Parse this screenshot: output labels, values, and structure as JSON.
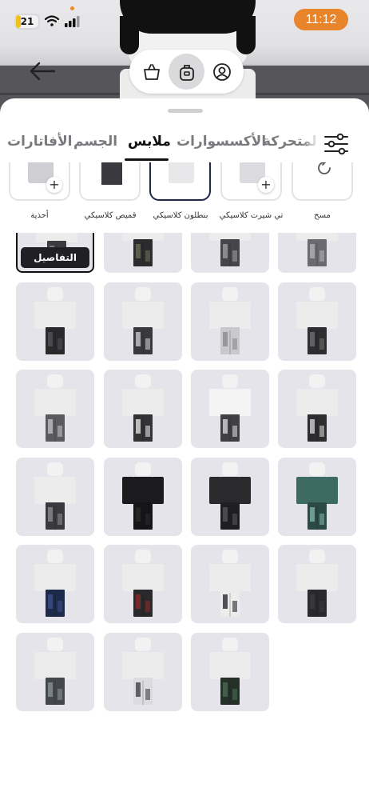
{
  "status_bar": {
    "battery": "21",
    "battery_level": 0.21,
    "time": "11:12"
  },
  "segments": [
    {
      "icon": "shopping-bag-icon",
      "active": false
    },
    {
      "icon": "backpack-icon",
      "active": true
    },
    {
      "icon": "person-icon",
      "active": false
    }
  ],
  "tabs": [
    {
      "label": "المتحركة",
      "active": false
    },
    {
      "label": "الأكسسوارات",
      "active": false
    },
    {
      "label": "ملابس",
      "active": true
    },
    {
      "label": "الجسم",
      "active": false
    },
    {
      "label": "الأفاتارات",
      "active": false
    }
  ],
  "categories": [
    {
      "label": "مسح",
      "icon": "reset-icon",
      "selected": false,
      "plus": false
    },
    {
      "label": "تي شيرت كلاسيكي",
      "icon": "tshirt-icon",
      "selected": false,
      "plus": true
    },
    {
      "label": "بنطلون كلاسيكي",
      "icon": "pants-icon",
      "selected": true,
      "plus": false
    },
    {
      "label": "قميص كلاسيكي",
      "icon": "shirt-icon",
      "selected": false,
      "plus": false
    },
    {
      "label": "أحذية",
      "icon": "shoes-icon",
      "selected": false,
      "plus": true
    }
  ],
  "grid": {
    "details_label": "التفاصيل",
    "items": [
      {
        "pants": "#3c3c40",
        "accent": "#8a8a90",
        "torso": "#ececec",
        "selected": true
      },
      {
        "pants": "#2c2c2f",
        "accent": "#6a6a55",
        "torso": "#ececec",
        "selected": false
      },
      {
        "pants": "#45454a",
        "accent": "#9c9ca0",
        "torso": "#ececec",
        "selected": false
      },
      {
        "pants": "#6a6a70",
        "accent": "#b0b0b6",
        "torso": "#ececec",
        "selected": false
      },
      {
        "pants": "#2a2a2d",
        "accent": "#505055",
        "torso": "#ececec",
        "selected": false
      },
      {
        "pants": "#3a3a3e",
        "accent": "#c8c8cc",
        "torso": "#ececec",
        "selected": false
      },
      {
        "pants": "#c9c9cc",
        "accent": "#8c8c90",
        "torso": "#ececec",
        "selected": false
      },
      {
        "pants": "#2e2e31",
        "accent": "#6e6e72",
        "torso": "#ececec",
        "selected": false
      },
      {
        "pants": "#5a5a5f",
        "accent": "#bdbdc2",
        "torso": "#ececec",
        "selected": false
      },
      {
        "pants": "#333336",
        "accent": "#e0e0e2",
        "torso": "#ececec",
        "selected": false
      },
      {
        "pants": "#404044",
        "accent": "#d5d5d8",
        "torso": "#f4f4f4",
        "selected": false
      },
      {
        "pants": "#2d2d30",
        "accent": "#cfcfd2",
        "torso": "#ececec",
        "selected": false
      },
      {
        "pants": "#3a3a3e",
        "accent": "#8a8a8e",
        "torso": "#ececec",
        "selected": false
      },
      {
        "pants": "#151517",
        "accent": "#2a2a2d",
        "torso": "#1b1b1d",
        "selected": false
      },
      {
        "pants": "#1f1f22",
        "accent": "#55555a",
        "torso": "#2a2a2d",
        "selected": false
      },
      {
        "pants": "#2b4a45",
        "accent": "#7fb0a5",
        "torso": "#3d6b63",
        "selected": false
      },
      {
        "pants": "#1e2a4a",
        "accent": "#3a4e8a",
        "torso": "#ececec",
        "selected": false
      },
      {
        "pants": "#2a2a2d",
        "accent": "#8a2a2a",
        "torso": "#ececec",
        "selected": false
      },
      {
        "pants": "#ececec",
        "accent": "#2a2a2d",
        "torso": "#ececec",
        "selected": false
      },
      {
        "pants": "#2a2a2d",
        "accent": "#3a3a3e",
        "torso": "#ececec",
        "selected": false
      },
      {
        "pants": "#44484e",
        "accent": "#8b9096",
        "torso": "#ececec",
        "selected": false
      },
      {
        "pants": "#dcdce0",
        "accent": "#404045",
        "torso": "#ececec",
        "selected": false
      },
      {
        "pants": "#243028",
        "accent": "#4a6a52",
        "torso": "#ececec",
        "selected": false
      }
    ]
  },
  "colors": {
    "accent": "#e8842a",
    "tile_bg": "#e4e4ea",
    "selected_border": "#1f2a4a"
  }
}
